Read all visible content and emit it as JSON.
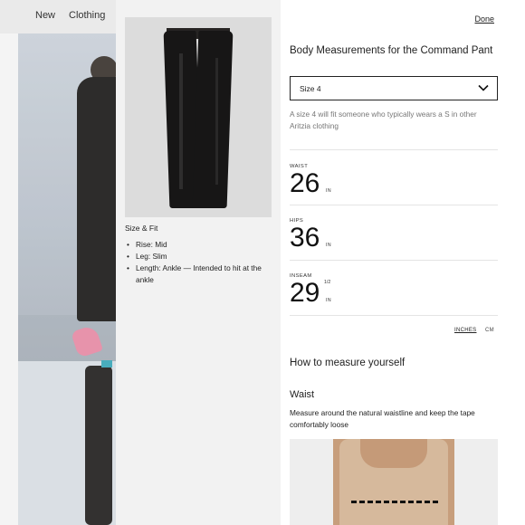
{
  "background": {
    "nav_items": [
      "New",
      "Clothing"
    ]
  },
  "modal": {
    "done_label": "Done",
    "title": "Body Measurements for the Command Pant",
    "size_select": {
      "selected": "Size 4",
      "chevron_icon": "chevron-down-icon"
    },
    "size_note": "A size 4 will fit someone who typically wears a S in other Aritzia clothing",
    "product": {
      "size_fit_title": "Size & Fit",
      "fit_items": [
        "Rise: Mid",
        "Leg: Slim",
        "Length: Ankle — Intended to hit at the ankle"
      ]
    },
    "measurements": [
      {
        "label": "WAIST",
        "value": "26",
        "fraction": "",
        "unit": "IN"
      },
      {
        "label": "HIPS",
        "value": "36",
        "fraction": "",
        "unit": "IN"
      },
      {
        "label": "INSEAM",
        "value": "29",
        "fraction": "1/2",
        "unit": "IN"
      }
    ],
    "unit_options": {
      "inches": "INCHES",
      "cm": "CM",
      "selected": "INCHES"
    },
    "how_to_title": "How to measure yourself",
    "waist_section": {
      "title": "Waist",
      "description": "Measure around the natural waistline and keep the tape comfortably loose"
    }
  }
}
